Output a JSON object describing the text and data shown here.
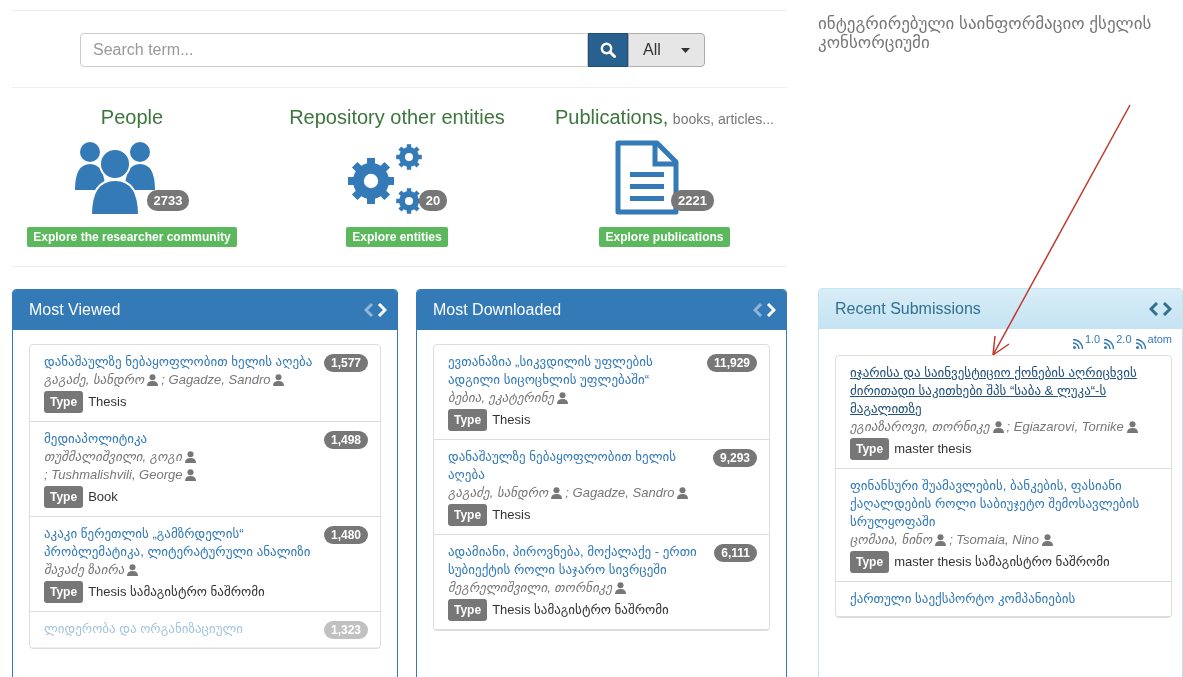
{
  "search": {
    "placeholder": "Search term...",
    "scope": "All"
  },
  "sections": [
    {
      "kind": "people",
      "title": "People",
      "count": "2733",
      "button": "Explore the researcher community"
    },
    {
      "kind": "entities",
      "title": "Repository other entities",
      "count": "20",
      "button": "Explore entities"
    },
    {
      "kind": "publications",
      "title": "Publications,",
      "subtitle": "books, articles...",
      "count": "2221",
      "button": "Explore publications"
    }
  ],
  "consortium": {
    "lines": [
      "ინტეგრირებული საინფორმაციო ქსელის",
      "კონსორციუმი"
    ]
  },
  "panels": [
    {
      "title": "Most Viewed",
      "kind": "carousel",
      "prev_disabled": true,
      "items": [
        {
          "title": "დანაშაულზე ნებაყოფლობით ხელის აღება",
          "authors": [
            "გაგაძე, სანდრო",
            "; Gagadze, Sandro"
          ],
          "count": "1,577",
          "type_label": "Type",
          "type": "Thesis",
          "faded": false,
          "hovered": false
        },
        {
          "title": "მედიაპოლიტიკა",
          "authors": [
            "თუშმალიშვილი, გოგი",
            "; Tushmalishvili, George"
          ],
          "count": "1,498",
          "type_label": "Type",
          "type": "Book",
          "faded": false,
          "hovered": false
        },
        {
          "title": "აკაკი წერეთლის „გამზრდელის“ პრობლემატიკა, ლიტერატურული ანალიზი",
          "authors": [
            "შავაძე ზაირა"
          ],
          "count": "1,480",
          "type_label": "Type",
          "type": "Thesis სამაგისტრო ნაშრომი",
          "faded": false,
          "hovered": false
        },
        {
          "title": "ლიდერობა და ორგანიზაციული",
          "count": "1,323",
          "faded": true,
          "hovered": false
        }
      ]
    },
    {
      "title": "Most Downloaded",
      "kind": "carousel",
      "prev_disabled": true,
      "items": [
        {
          "title": "ევთანაზია „სიკვდილის უფლების ადგილი სიცოცხლის უფლებაში“",
          "authors": [
            "ბებია, ეკატერინე"
          ],
          "count": "11,929",
          "type_label": "Type",
          "type": "Thesis",
          "faded": false,
          "hovered": false
        },
        {
          "title": "დანაშაულზე ნებაყოფლობით ხელის აღება",
          "authors": [
            "გაგაძე, სანდრო",
            "; Gagadze, Sandro"
          ],
          "count": "9,293",
          "type_label": "Type",
          "type": "Thesis",
          "faded": false,
          "hovered": false
        },
        {
          "title": "ადამიანი, პიროვნება, მოქალაქე - ერთი სუბიექტის როლი საჯარო სივრცეში",
          "authors": [
            "მეგრელიშვილი, თორნიკე"
          ],
          "count": "6,111",
          "type_label": "Type",
          "type": "Thesis სამაგისტრო ნაშრომი",
          "faded": false,
          "hovered": false
        }
      ]
    },
    {
      "title": "Recent Submissions",
      "kind": "recent",
      "prev_disabled": false,
      "feeds": [
        "1.0",
        "2.0",
        "atom"
      ],
      "items": [
        {
          "title": "იჯარისა და საინვესტიციო ქონების აღრიცხვის ძირითადი საკითხები შპს “საბა & ლუკა“-ს მაგალითზე",
          "authors": [
            "ეგიაზაროვი, თორნიკე",
            "; Egiazarovi, Tornike"
          ],
          "type_label": "Type",
          "type": "master thesis",
          "faded": false,
          "hovered": true
        },
        {
          "title": "ფინანსური შუამავლების, ბანკების, ფასიანი ქაღალდების როლი საბიუჯეტო შემოსავლების სრულყოფაში",
          "authors": [
            "ცომაია, ნინო",
            "; Tsomaia, Nino"
          ],
          "type_label": "Type",
          "type": "master thesis სამაგისტრო ნაშრომი",
          "faded": false,
          "hovered": false
        },
        {
          "title": "ქართული საექსპორტო კომპანიების",
          "faded": false,
          "hovered": false
        }
      ]
    }
  ]
}
